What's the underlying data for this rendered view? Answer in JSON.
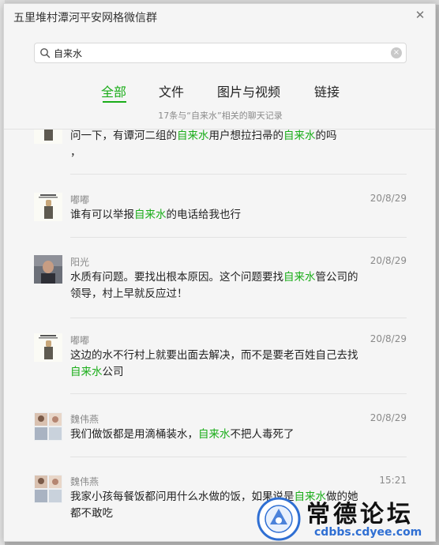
{
  "window": {
    "title": "五里堆村潭河平安网格微信群",
    "close_glyph": "✕"
  },
  "search": {
    "value": "自来水",
    "clear_glyph": "×"
  },
  "tabs": [
    {
      "label": "全部",
      "active": true
    },
    {
      "label": "文件",
      "active": false
    },
    {
      "label": "图片与视频",
      "active": false
    },
    {
      "label": "链接",
      "active": false
    }
  ],
  "result_summary": "17条与“自来水”相关的聊天记录",
  "keyword": "自来水",
  "accent_color": "#1aad19",
  "messages": [
    {
      "sender": "",
      "date": "",
      "avatar": "poster-avatar",
      "parts": [
        "问一下，有谭河二组的",
        "自来水",
        "用户想拉扫帚的",
        "自来水",
        "的吗"
      ],
      "tail": "，"
    },
    {
      "sender": "嘟嘟",
      "date": "20/8/29",
      "avatar": "poster-avatar",
      "parts": [
        "谁有可以举报",
        "自来水",
        "的电话给我也行"
      ]
    },
    {
      "sender": "阳光",
      "date": "20/8/29",
      "avatar": "photo-avatar",
      "parts": [
        "水质有问题。要找出根本原因。这个问题要找",
        "自来水",
        "管公司的领导，村上早就反应过！"
      ]
    },
    {
      "sender": "嘟嘟",
      "date": "20/8/29",
      "avatar": "poster-avatar",
      "parts": [
        "这边的水不行村上就要出面去解决，而不是要老百姓自己去找",
        "自来水",
        "公司"
      ]
    },
    {
      "sender": "魏伟燕",
      "date": "20/8/29",
      "avatar": "grid-avatar",
      "parts": [
        "我们做饭都是用滴桶装水，",
        "自来水",
        "不把人毒死了"
      ]
    },
    {
      "sender": "魏伟燕",
      "date": "15:21",
      "avatar": "grid-avatar",
      "parts": [
        "我家小孩每餐饭都问用什么水做的饭，如果说是",
        "自来水",
        "做的她都不敢吃"
      ]
    }
  ],
  "watermark": {
    "text": "常德论坛",
    "url": "cdbbs.cdyee.com"
  }
}
